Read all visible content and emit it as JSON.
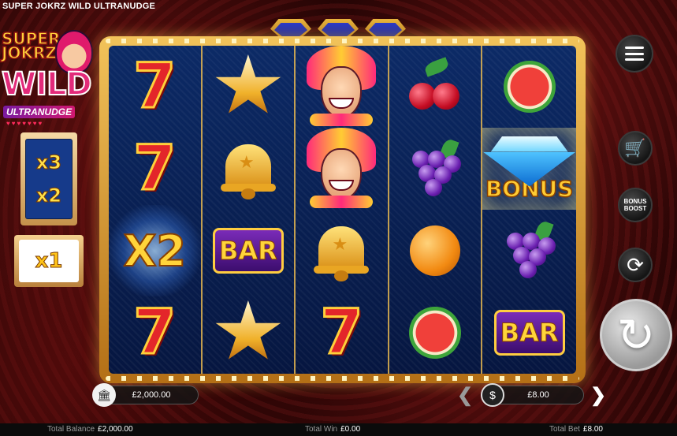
{
  "window": {
    "title": "SUPER JOKRZ WILD ULTRANUDGE"
  },
  "logo": {
    "line1": "SUPER",
    "line2": "JOKRZ",
    "line3": "WILD",
    "tagline": "ULTRANUDGE"
  },
  "multipliers": {
    "ladder": [
      "x3",
      "x2"
    ],
    "current": "x1"
  },
  "reels": [
    [
      "seven",
      "seven",
      "x2",
      "seven"
    ],
    [
      "star",
      "bell",
      "bar",
      "star"
    ],
    [
      "jester",
      "jester",
      "bell",
      "seven"
    ],
    [
      "cherry",
      "grape",
      "orange",
      "melon"
    ],
    [
      "melon",
      "diamond-bonus",
      "grape",
      "bar"
    ]
  ],
  "symbols": {
    "seven": "7",
    "bar": "BAR",
    "x2": "X2",
    "bonus": "BONUS"
  },
  "controls": {
    "boost_label_1": "BONUS",
    "boost_label_2": "BOOST"
  },
  "balance_pill": {
    "value": "£2,000.00"
  },
  "bet_pill": {
    "value": "£8.00"
  },
  "footer": {
    "total_balance_label": "Total Balance",
    "total_balance_value": "£2,000.00",
    "total_win_label": "Total Win",
    "total_win_value": "£0.00",
    "total_bet_label": "Total Bet",
    "total_bet_value": "£8.00"
  },
  "colors": {
    "frame_gold": "#f2c35a",
    "reel_bg": "#0c2a66",
    "seven_red": "#e3262a",
    "bar_purple": "#7a2bb8"
  }
}
